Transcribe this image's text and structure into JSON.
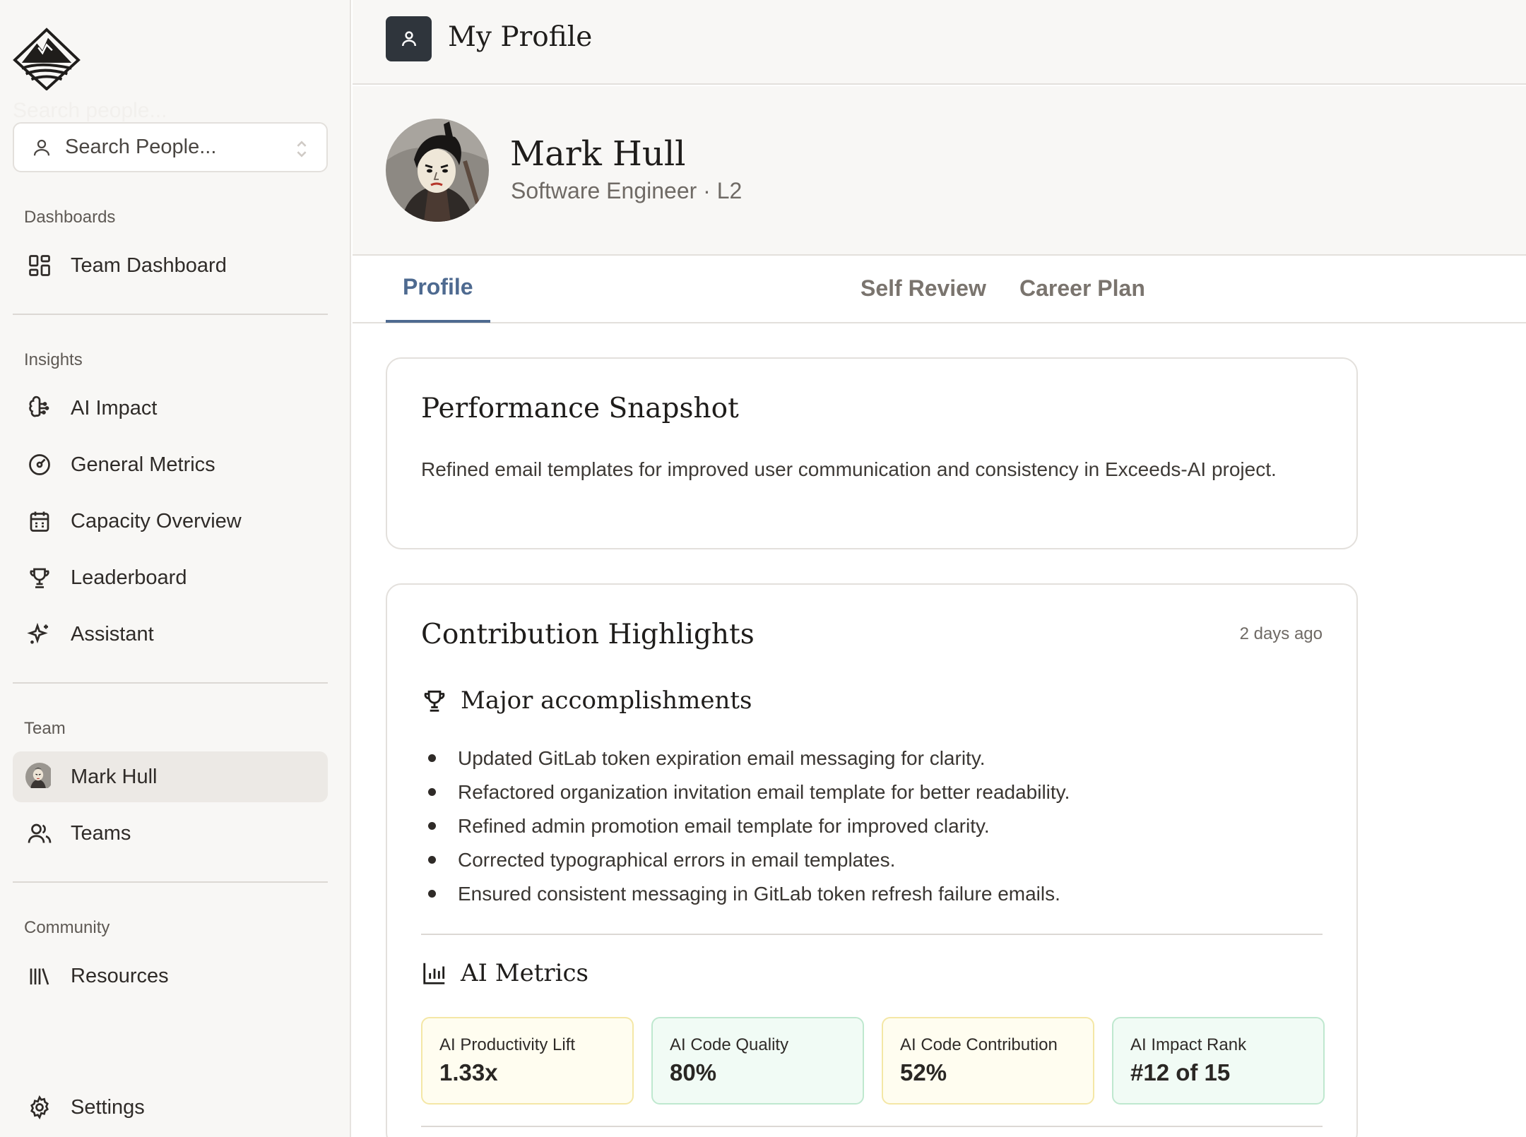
{
  "sidebar": {
    "search_ghost": "Search people...",
    "search_placeholder": "Search People...",
    "sections": {
      "dashboards": "Dashboards",
      "insights": "Insights",
      "team": "Team",
      "community": "Community"
    },
    "items": {
      "team_dashboard": "Team Dashboard",
      "ai_impact": "AI Impact",
      "general_metrics": "General Metrics",
      "capacity_overview": "Capacity Overview",
      "leaderboard": "Leaderboard",
      "assistant": "Assistant",
      "mark_hull": "Mark Hull",
      "teams": "Teams",
      "resources": "Resources",
      "settings": "Settings"
    }
  },
  "header": {
    "title": "My Profile"
  },
  "profile": {
    "name": "Mark Hull",
    "role": "Software Engineer · L2"
  },
  "tabs": {
    "profile": "Profile",
    "self_review": "Self Review",
    "career_plan": "Career Plan"
  },
  "snapshot": {
    "title": "Performance Snapshot",
    "text": "Refined email templates for improved user communication and consistency in Exceeds-AI project."
  },
  "highlights": {
    "title": "Contribution Highlights",
    "timestamp": "2 days ago",
    "accomplishments_title": "Major accomplishments",
    "accomplishments": [
      "Updated GitLab token expiration email messaging for clarity.",
      "Refactored organization invitation email template for better readability.",
      "Refined admin promotion email template for improved clarity.",
      "Corrected typographical errors in email templates.",
      "Ensured consistent messaging in GitLab token refresh failure emails."
    ],
    "metrics_title": "AI Metrics",
    "metrics": [
      {
        "label": "AI Productivity Lift",
        "value": "1.33x",
        "tone": "yellow"
      },
      {
        "label": "AI Code Quality",
        "value": "80%",
        "tone": "green"
      },
      {
        "label": "AI Code Contribution",
        "value": "52%",
        "tone": "yellow"
      },
      {
        "label": "AI Impact Rank",
        "value": "#12 of 15",
        "tone": "green"
      }
    ]
  },
  "colors": {
    "accent": "#4e6a90",
    "sidebar_bg": "#f8f7f5",
    "metric_yellow_bg": "#fffdf0",
    "metric_green_bg": "#f1fbf5"
  }
}
